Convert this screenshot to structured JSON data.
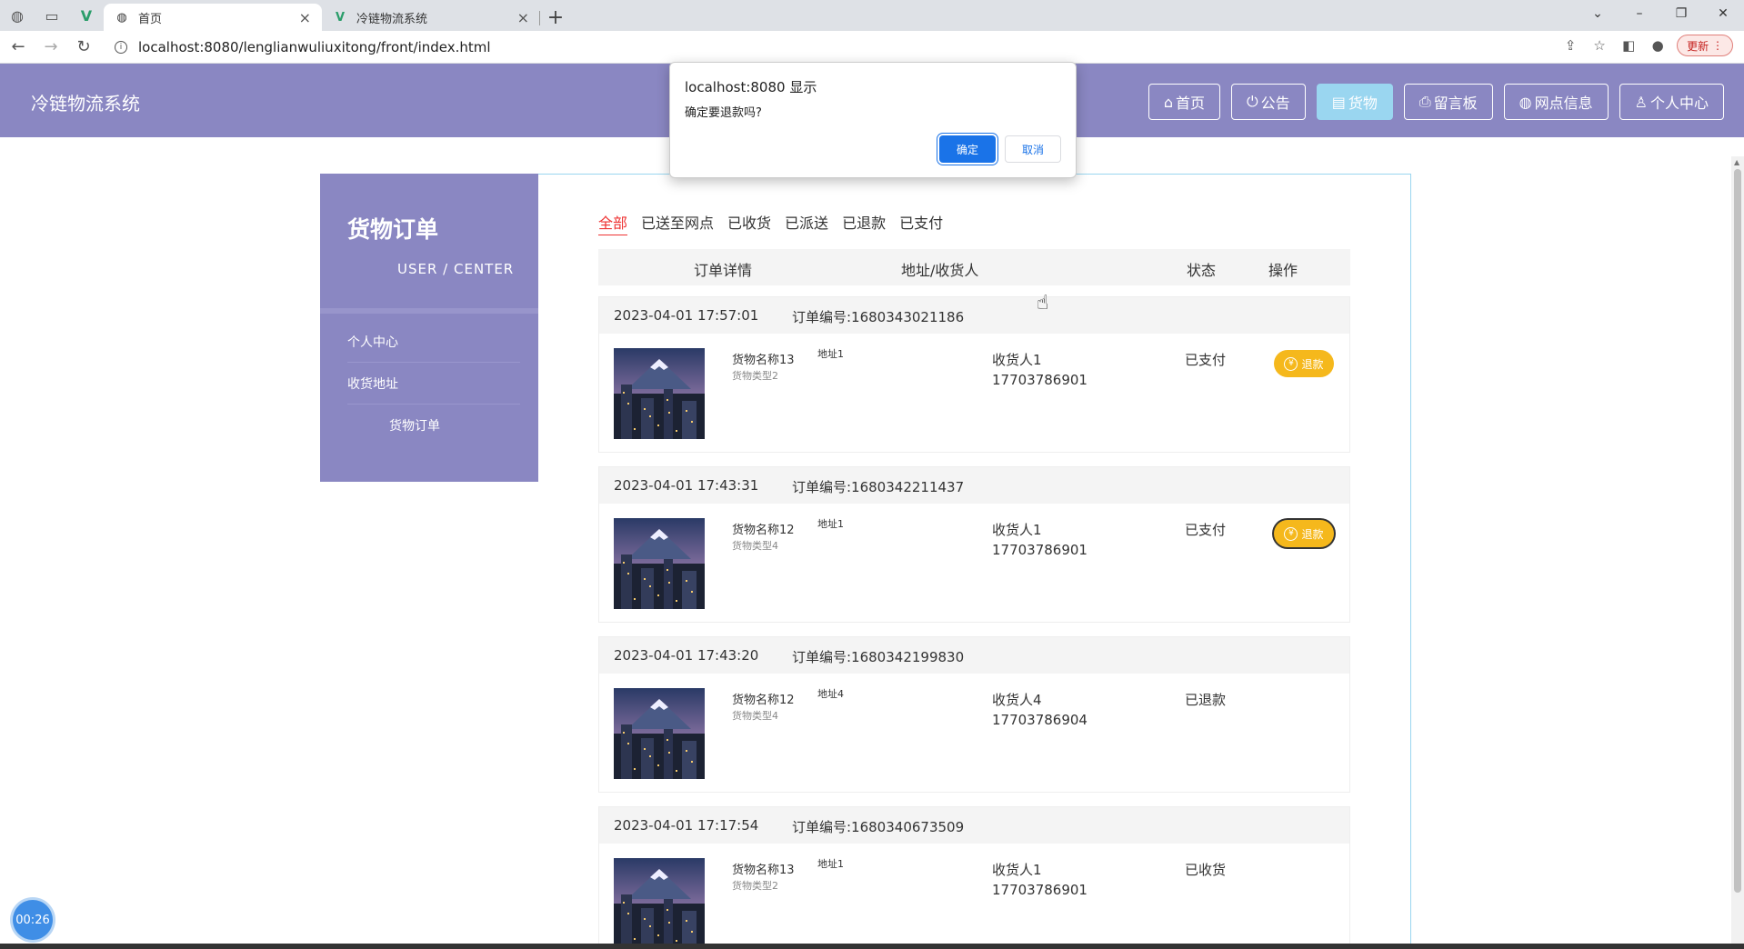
{
  "browser": {
    "tabs": [
      {
        "title": "首页",
        "active": true
      },
      {
        "title": "冷链物流系统",
        "active": false
      }
    ],
    "url": "localhost:8080/lenglianwuliuxitong/front/index.html",
    "update_label": "更新"
  },
  "header": {
    "site_title": "冷链物流系统",
    "nav": [
      {
        "label": "首页",
        "icon": "home-icon",
        "glyph": "⌂",
        "active": false
      },
      {
        "label": "公告",
        "icon": "power-icon",
        "glyph": "⏻",
        "active": false
      },
      {
        "label": "货物",
        "icon": "document-icon",
        "glyph": "▤",
        "active": true
      },
      {
        "label": "留言板",
        "icon": "print-icon",
        "glyph": "⎙",
        "active": false
      },
      {
        "label": "网点信息",
        "icon": "globe-icon",
        "glyph": "◍",
        "active": false
      },
      {
        "label": "个人中心",
        "icon": "user-icon",
        "glyph": "♙",
        "active": false
      }
    ]
  },
  "sidebar": {
    "title": "货物订单",
    "subtitle": "USER / CENTER",
    "items": [
      {
        "label": "个人中心"
      },
      {
        "label": "收货地址"
      },
      {
        "label": "货物订单"
      }
    ]
  },
  "filters": [
    "全部",
    "已送至网点",
    "已收货",
    "已派送",
    "已退款",
    "已支付"
  ],
  "active_filter": "全部",
  "table": {
    "columns": [
      "订单详情",
      "地址/收货人",
      "状态",
      "操作"
    ]
  },
  "orders": [
    {
      "time": "2023-04-01 17:57:01",
      "order_no": "订单编号:1680343021186",
      "goods_name": "货物名称13",
      "goods_type": "货物类型2",
      "address": "地址1",
      "receiver": "收货人1",
      "phone": "17703786901",
      "status": "已支付",
      "action": "退款"
    },
    {
      "time": "2023-04-01 17:43:31",
      "order_no": "订单编号:1680342211437",
      "goods_name": "货物名称12",
      "goods_type": "货物类型4",
      "address": "地址1",
      "receiver": "收货人1",
      "phone": "17703786901",
      "status": "已支付",
      "action": "退款"
    },
    {
      "time": "2023-04-01 17:43:20",
      "order_no": "订单编号:1680342199830",
      "goods_name": "货物名称12",
      "goods_type": "货物类型4",
      "address": "地址4",
      "receiver": "收货人4",
      "phone": "17703786904",
      "status": "已退款",
      "action": ""
    },
    {
      "time": "2023-04-01 17:17:54",
      "order_no": "订单编号:1680340673509",
      "goods_name": "货物名称13",
      "goods_type": "货物类型2",
      "address": "地址1",
      "receiver": "收货人1",
      "phone": "17703786901",
      "status": "已收货",
      "action": ""
    }
  ],
  "dialog": {
    "title": "localhost:8080 显示",
    "message": "确定要退款吗?",
    "ok_label": "确定",
    "cancel_label": "取消"
  },
  "timer": "00:26",
  "colors": {
    "header_bg": "#8a87c2",
    "nav_active": "#9ad6f0",
    "refund_btn": "#f5b81c",
    "filter_active": "#e33333",
    "dialog_primary": "#1a73e8"
  }
}
